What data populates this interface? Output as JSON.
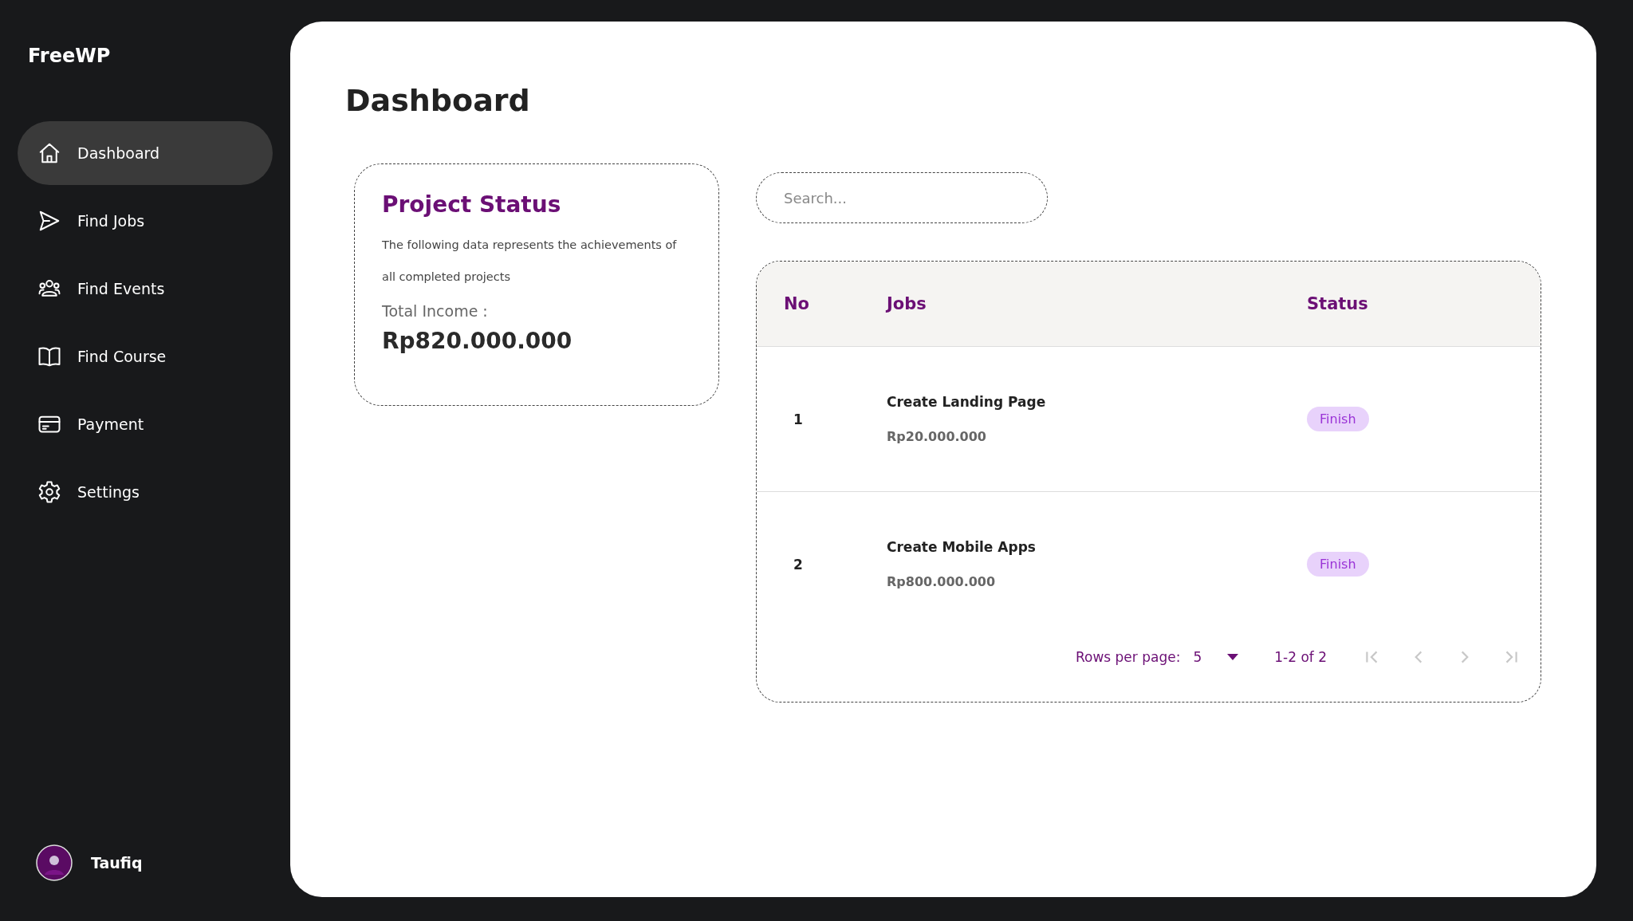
{
  "sidebar": {
    "logo": "FreeWP",
    "items": [
      {
        "label": "Dashboard",
        "kind": "home",
        "selected": true
      },
      {
        "label": "Find Jobs",
        "kind": "send",
        "selected": false
      },
      {
        "label": "Find Events",
        "kind": "people",
        "selected": false
      },
      {
        "label": "Find Course",
        "kind": "book",
        "selected": false
      },
      {
        "label": "Payment",
        "kind": "card",
        "selected": false
      },
      {
        "label": "Settings",
        "kind": "gear",
        "selected": false
      }
    ],
    "user": {
      "name": "Taufiq"
    }
  },
  "page_title": "Dashboard",
  "project_status": {
    "title": "Project Status",
    "description": "The following data represents the achievements of all completed projects",
    "income_label": "Total Income :",
    "income_value": "Rp820.000.000"
  },
  "search": {
    "placeholder": "Search..."
  },
  "table": {
    "columns": [
      "No",
      "Jobs",
      "Status"
    ],
    "rows": [
      {
        "no": "1",
        "job": "Create Landing Page",
        "price": "Rp20.000.000",
        "status": "Finish"
      },
      {
        "no": "2",
        "job": "Create Mobile Apps",
        "price": "Rp800.000.000",
        "status": "Finish"
      }
    ],
    "pagination": {
      "rows_label": "Rows per page:",
      "rows_value": "5",
      "range": "1-2 of 2"
    }
  }
}
